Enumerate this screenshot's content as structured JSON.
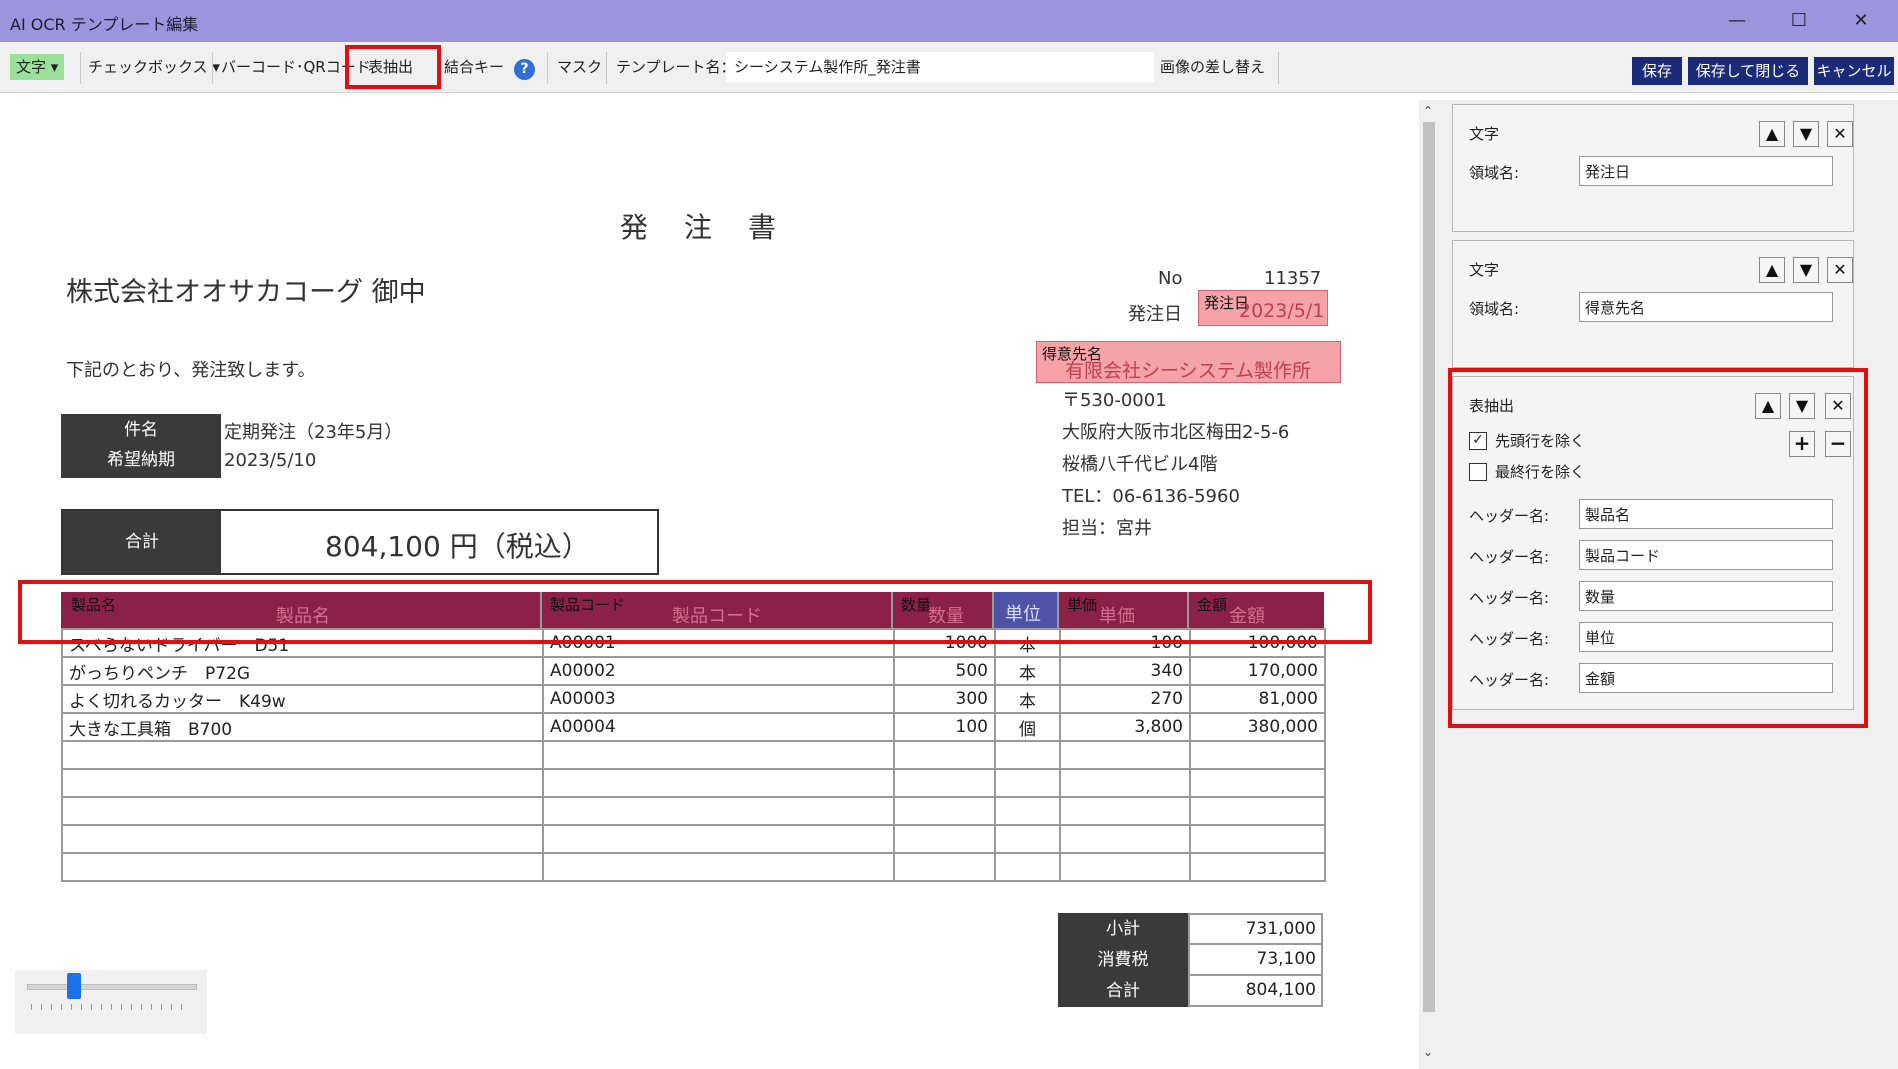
{
  "window": {
    "title": "AI OCR テンプレート編集",
    "minimize": "—",
    "maximize": "☐",
    "close": "✕"
  },
  "toolbar": {
    "text_dropdown": "文字 ▾",
    "checkbox_dropdown": "チェックボックス ▾",
    "barcode": "バーコード･QRコード",
    "table_extract": "表抽出",
    "join_key": "結合キー",
    "help": "?",
    "mask": "マスク",
    "template_name_label": "テンプレート名：",
    "template_name_value": "シーシステム製作所_発注書",
    "replace_image": "画像の差し替え",
    "save": "保存",
    "save_close": "保存して閉じる",
    "cancel": "キャンセル"
  },
  "doc": {
    "title": "発　注　書",
    "recipient": "株式会社オオサカコーグ 御中",
    "intro": "下記のとおり、発注致します。",
    "no_label": "No",
    "no_value": "11357",
    "order_date_label": "発注日",
    "order_date_region": "発注日",
    "order_date_value": "2023/5/1",
    "customer_region": "得意先名",
    "customer_value": "有限会社シーシステム製作所",
    "postal": "〒530-0001",
    "address1": "大阪府大阪市北区梅田2-5-6",
    "address2": "桜橋八千代ビル4階",
    "tel": "TEL：06-6136-5960",
    "person": "担当：宮井",
    "subject_label": "件名",
    "subject_value": "定期発注（23年5月）",
    "due_label": "希望納期",
    "due_value": "2023/5/10",
    "total_label": "合計",
    "total_value": "804,100 円（税込）",
    "header_labels": [
      "製品名",
      "製品コード",
      "数量",
      "単位",
      "単価",
      "金額"
    ],
    "header_ghost": [
      "製品名",
      "製品コード",
      "数量",
      "単位",
      "単価",
      "金額"
    ],
    "rows": [
      [
        "スベらないドライバー　D51",
        "A00001",
        "1000",
        "本",
        "100",
        "100,000"
      ],
      [
        "がっちりペンチ　P72G",
        "A00002",
        "500",
        "本",
        "340",
        "170,000"
      ],
      [
        "よく切れるカッター　K49w",
        "A00003",
        "300",
        "本",
        "270",
        "81,000"
      ],
      [
        "大きな工具箱　B700",
        "A00004",
        "100",
        "個",
        "3,800",
        "380,000"
      ]
    ],
    "subtotal_label": "小計",
    "subtotal_value": "731,000",
    "tax_label": "消費税",
    "tax_value": "73,100",
    "grand_label": "合計",
    "grand_value": "804,100"
  },
  "panel": {
    "card1": {
      "type": "文字",
      "region_label": "領域名:",
      "region_value": "発注日"
    },
    "card2": {
      "type": "文字",
      "region_label": "領域名:",
      "region_value": "得意先名"
    },
    "card3": {
      "type": "表抽出",
      "exclude_first": "先頭行を除く",
      "exclude_first_checked": true,
      "exclude_last": "最終行を除く",
      "exclude_last_checked": false,
      "header_label": "ヘッダー名:",
      "headers": [
        "製品名",
        "製品コード",
        "数量",
        "単位",
        "金額"
      ]
    },
    "up": "▲",
    "down": "▼",
    "remove": "✕",
    "plus": "+",
    "minus": "−"
  },
  "zoom_slider_level": 0.28,
  "colors": {
    "titlebar": "#9a95dc",
    "accent": "#1c2b78",
    "highlight_red": "#e01010",
    "region_pink": "#f4a3a8",
    "table_header": "#8b2146"
  }
}
